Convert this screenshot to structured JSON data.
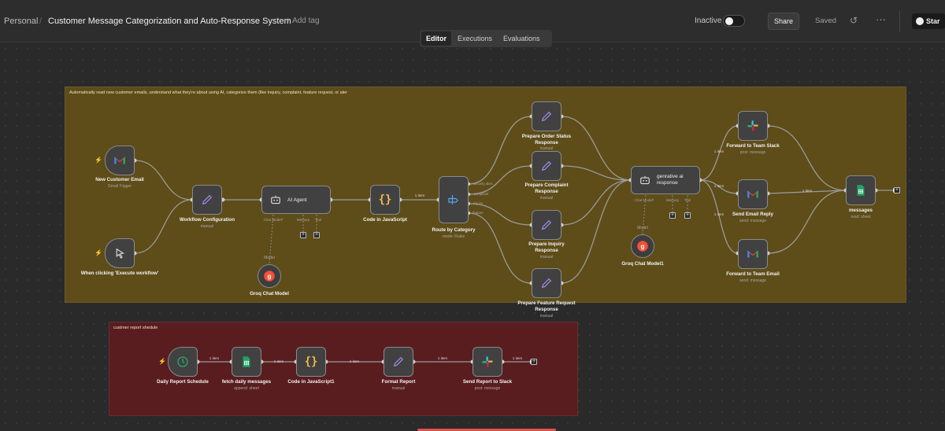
{
  "header": {
    "workspace": "Personal",
    "separator": "/",
    "workflow_title": "Customer Message Categorization and Auto-Response System",
    "add_tag": "+ Add tag",
    "status": "Inactive",
    "share": "Share",
    "saved": "Saved",
    "more": "···",
    "star": "Star"
  },
  "tabs": [
    "Editor",
    "Executions",
    "Evaluations"
  ],
  "notes": {
    "main": "Automatically read new customer emails, understand what they're about using AI, categorize them (like inquiry, complaint, feature request, or aler",
    "report": "custmer report shedule"
  },
  "nodes": {
    "new_email": {
      "label": "New Customer Email",
      "sub": "Gmail Trigger"
    },
    "manual": {
      "label": "When clicking 'Execute workflow'"
    },
    "workflow_config": {
      "label": "Workflow Configuration",
      "sub": "manual"
    },
    "ai_agent": {
      "label": "AI Agent",
      "ports": [
        "Chat Model*",
        "Memory",
        "Tool"
      ]
    },
    "groq1": {
      "label": "Groq Chat Model",
      "sub": "Model"
    },
    "code_js": {
      "label": "Code in JavaScript"
    },
    "route": {
      "label": "Route by Category",
      "sub": "mode: Rules",
      "outputs": [
        "security alert",
        "complaint",
        "inquiry",
        "feature"
      ]
    },
    "order_status": {
      "label": "Prepare Order Status Response",
      "sub": "manual"
    },
    "complaint": {
      "label": "Prepare Complaint Response",
      "sub": "manual"
    },
    "inquiry": {
      "label": "Prepare Inquiry Response",
      "sub": "manual"
    },
    "feature": {
      "label": "Prepare Feature Request Response",
      "sub": "manual"
    },
    "genrative": {
      "label": "genrative ai response",
      "ports": [
        "Chat Model*",
        "Memory",
        "Tool"
      ]
    },
    "groq2": {
      "label": "Groq Chat Model1",
      "sub": "Model"
    },
    "slack_team": {
      "label": "Forward to Team Slack",
      "sub": "post: message"
    },
    "send_reply": {
      "label": "Send Email Reply",
      "sub": "send: message"
    },
    "team_email": {
      "label": "Forward to Team Email",
      "sub": "send: message"
    },
    "messages": {
      "label": "messages",
      "sub": "read: sheet"
    },
    "daily_schedule": {
      "label": "Daily Report Schedule"
    },
    "fetch_daily": {
      "label": "fetch daily messages",
      "sub": "append: sheet"
    },
    "code_js1": {
      "label": "Code in JavaScript1"
    },
    "format_report": {
      "label": "Format Report",
      "sub": "manual"
    },
    "send_slack": {
      "label": "Send Report to Slack",
      "sub": "post: message"
    }
  },
  "wire_labels": {
    "one_item": "1 item"
  },
  "colors": {
    "note_yellow": "#5e4d19",
    "note_red": "#5a1d1f",
    "gmail_red": "#ea4335",
    "sheets_green": "#1fa463",
    "schedule_green": "#2ea56a",
    "groq_orange": "#f55036"
  }
}
